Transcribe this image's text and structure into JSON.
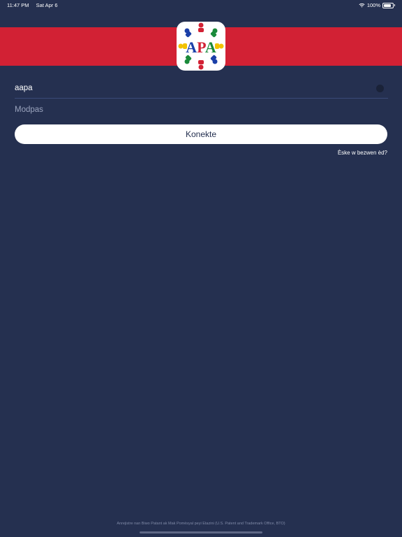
{
  "status_bar": {
    "time": "11:47 PM",
    "date": "Sat Apr 6",
    "battery": "100%"
  },
  "logo": {
    "text": "APA"
  },
  "form": {
    "username_value": "aapa",
    "password_placeholder": "Modpas",
    "login_label": "Konekte",
    "forgot_label": "Èske w bezwen èd?"
  },
  "footer": {
    "text": "Anrejistre nan Biwo Patant ak Mak Pomèsyal peyi Etazini (U.S. Patent and Trademark Office, BTO)"
  },
  "colors": {
    "background": "#253050",
    "brand_red": "#d22134",
    "button": "#ffffff"
  }
}
